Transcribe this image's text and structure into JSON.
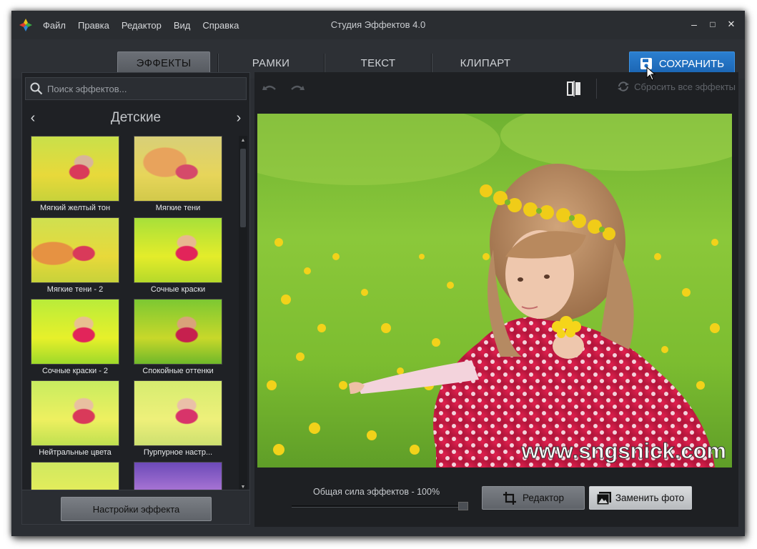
{
  "window": {
    "title": "Студия Эффектов 4.0",
    "controls": {
      "minimize": "–",
      "maximize": "□",
      "close": "✕"
    }
  },
  "menu": [
    "Файл",
    "Правка",
    "Редактор",
    "Вид",
    "Справка"
  ],
  "tabs": [
    {
      "label": "ЭФФЕКТЫ",
      "active": true
    },
    {
      "label": "РАМКИ",
      "active": false
    },
    {
      "label": "ТЕКСТ",
      "active": false
    },
    {
      "label": "КЛИПАРТ",
      "active": false
    }
  ],
  "save_button": {
    "label": "СОХРАНИТЬ",
    "icon": "floppy-disk-icon",
    "color": "#1f6fc2"
  },
  "effects_panel": {
    "search_placeholder": "Поиск эффектов...",
    "category": "Детские",
    "prev_arrow": "‹",
    "next_arrow": "›",
    "effects": [
      {
        "label": "Мягкий желтый тон"
      },
      {
        "label": "Мягкие тени"
      },
      {
        "label": "Мягкие тени - 2"
      },
      {
        "label": "Сочные краски"
      },
      {
        "label": "Сочные краски - 2"
      },
      {
        "label": "Спокойные оттенки"
      },
      {
        "label": "Нейтральные цвета"
      },
      {
        "label": "Пурпурное настр..."
      },
      {
        "label": ""
      },
      {
        "label": ""
      }
    ],
    "settings_button": "Настройки эффекта"
  },
  "preview_toolbar": {
    "undo_icon": "undo-icon",
    "redo_icon": "redo-icon",
    "compare_icon": "compare-icon",
    "reset_label": "Сбросить все эффекты"
  },
  "photo": {
    "watermark": "www.sngsnick.com"
  },
  "bottom": {
    "strength_label": "Общая сила эффектов - 100%",
    "strength_value": 1.0,
    "editor_button": "Редактор",
    "replace_button": "Заменить фото"
  }
}
